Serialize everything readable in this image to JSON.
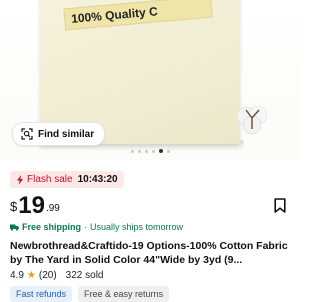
{
  "hero": {
    "badge_text": "100% Quality C",
    "find_similar_label": "Find similar",
    "find_similar_icon": "image-search-icon",
    "carousel_total": 6,
    "carousel_active_index": 4
  },
  "flash": {
    "label": "Flash sale",
    "time": "10:43:20",
    "icon": "lightning-icon",
    "color": "#c8102e"
  },
  "price": {
    "currency": "$",
    "whole": "19",
    "cents": ".99"
  },
  "shipping": {
    "free_label": "Free shipping",
    "separator": "·",
    "usually": "Usually ships tomorrow",
    "icon": "truck-icon",
    "color": "#0a7a4a"
  },
  "product": {
    "title": "Newbrothread&Craftido-19 Options-100% Cotton Fabric by The Yard in Solid Color 44\"Wide by 3yd (9..."
  },
  "rating": {
    "score": "4.9",
    "star": "★",
    "count": "(20)",
    "sold": "322 sold"
  },
  "chips": [
    {
      "label": "Fast refunds"
    },
    {
      "label": "Free & easy returns"
    }
  ]
}
